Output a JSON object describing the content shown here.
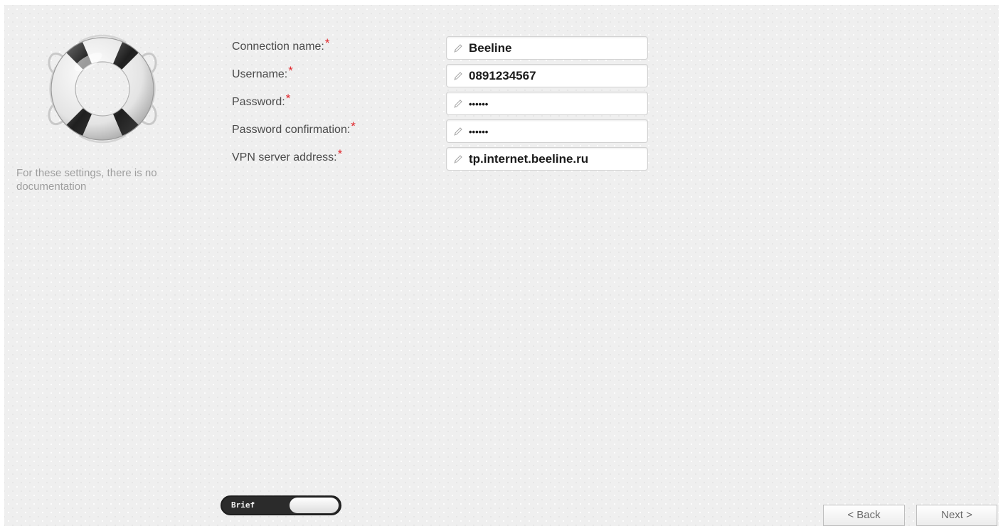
{
  "help": {
    "icon": "lifebuoy-icon",
    "text": "For these settings, there is no documentation"
  },
  "form": {
    "required_marker": "*",
    "fields": [
      {
        "label": "Connection name:",
        "value": "Beeline",
        "masked": false
      },
      {
        "label": "Username:",
        "value": "0891234567",
        "masked": false
      },
      {
        "label": "Password:",
        "value": "••••••",
        "masked": true
      },
      {
        "label": "Password confirmation:",
        "value": "••••••",
        "masked": true
      },
      {
        "label": "VPN server address:",
        "value": "tp.internet.beeline.ru",
        "masked": false
      }
    ]
  },
  "mode_toggle": {
    "label": "Brief",
    "state": "brief"
  },
  "navigation": {
    "back_label": "< Back",
    "next_label": "Next >"
  },
  "colors": {
    "required_marker": "#e0262b",
    "background": "#efefef",
    "label_text": "#4b4b4b",
    "help_text": "#9e9e9e"
  }
}
